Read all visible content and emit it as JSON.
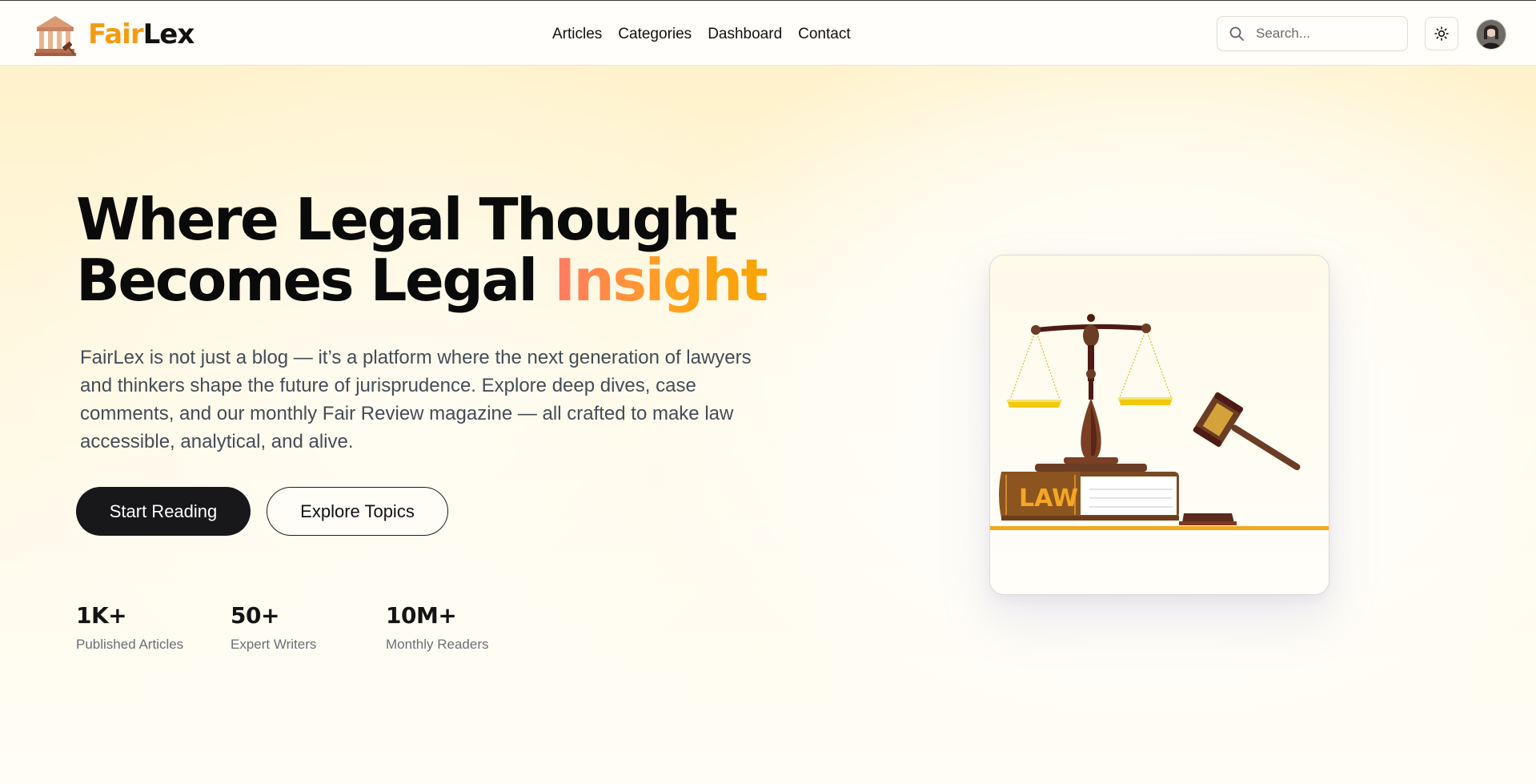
{
  "brand": {
    "name_part1": "Fair",
    "name_part2": "Lex",
    "logo_icon": "courthouse-gavel-icon"
  },
  "nav": {
    "items": [
      {
        "label": "Articles"
      },
      {
        "label": "Categories"
      },
      {
        "label": "Dashboard"
      },
      {
        "label": "Contact"
      }
    ]
  },
  "search": {
    "placeholder": "Search...",
    "value": "",
    "icon": "search-icon"
  },
  "theme_toggle": {
    "icon": "sun-icon"
  },
  "hero": {
    "title_line1": "Where Legal Thought",
    "title_line2_prefix": "Becomes Legal ",
    "title_accent": "Insight",
    "description": "FairLex is not just a blog — it’s a platform where the next generation of lawyers and thinkers shape the future of jurisprudence. Explore deep dives, case comments, and our monthly Fair Review magazine — all crafted to make law accessible, analytical, and alive.",
    "primary_button": "Start Reading",
    "secondary_button": "Explore Topics"
  },
  "stats": [
    {
      "value": "1K+",
      "label": "Published Articles"
    },
    {
      "value": "50+",
      "label": "Expert Writers"
    },
    {
      "value": "10M+",
      "label": "Monthly Readers"
    }
  ],
  "illustration": {
    "book_label": "LAW",
    "icons": [
      "scales-of-justice-icon",
      "law-book-icon",
      "gavel-icon"
    ]
  },
  "colors": {
    "brand_orange": "#f39c12",
    "accent_gradient_start": "#ff7a66",
    "accent_gradient_end": "#f7a400",
    "primary_button_bg": "#18181b"
  }
}
